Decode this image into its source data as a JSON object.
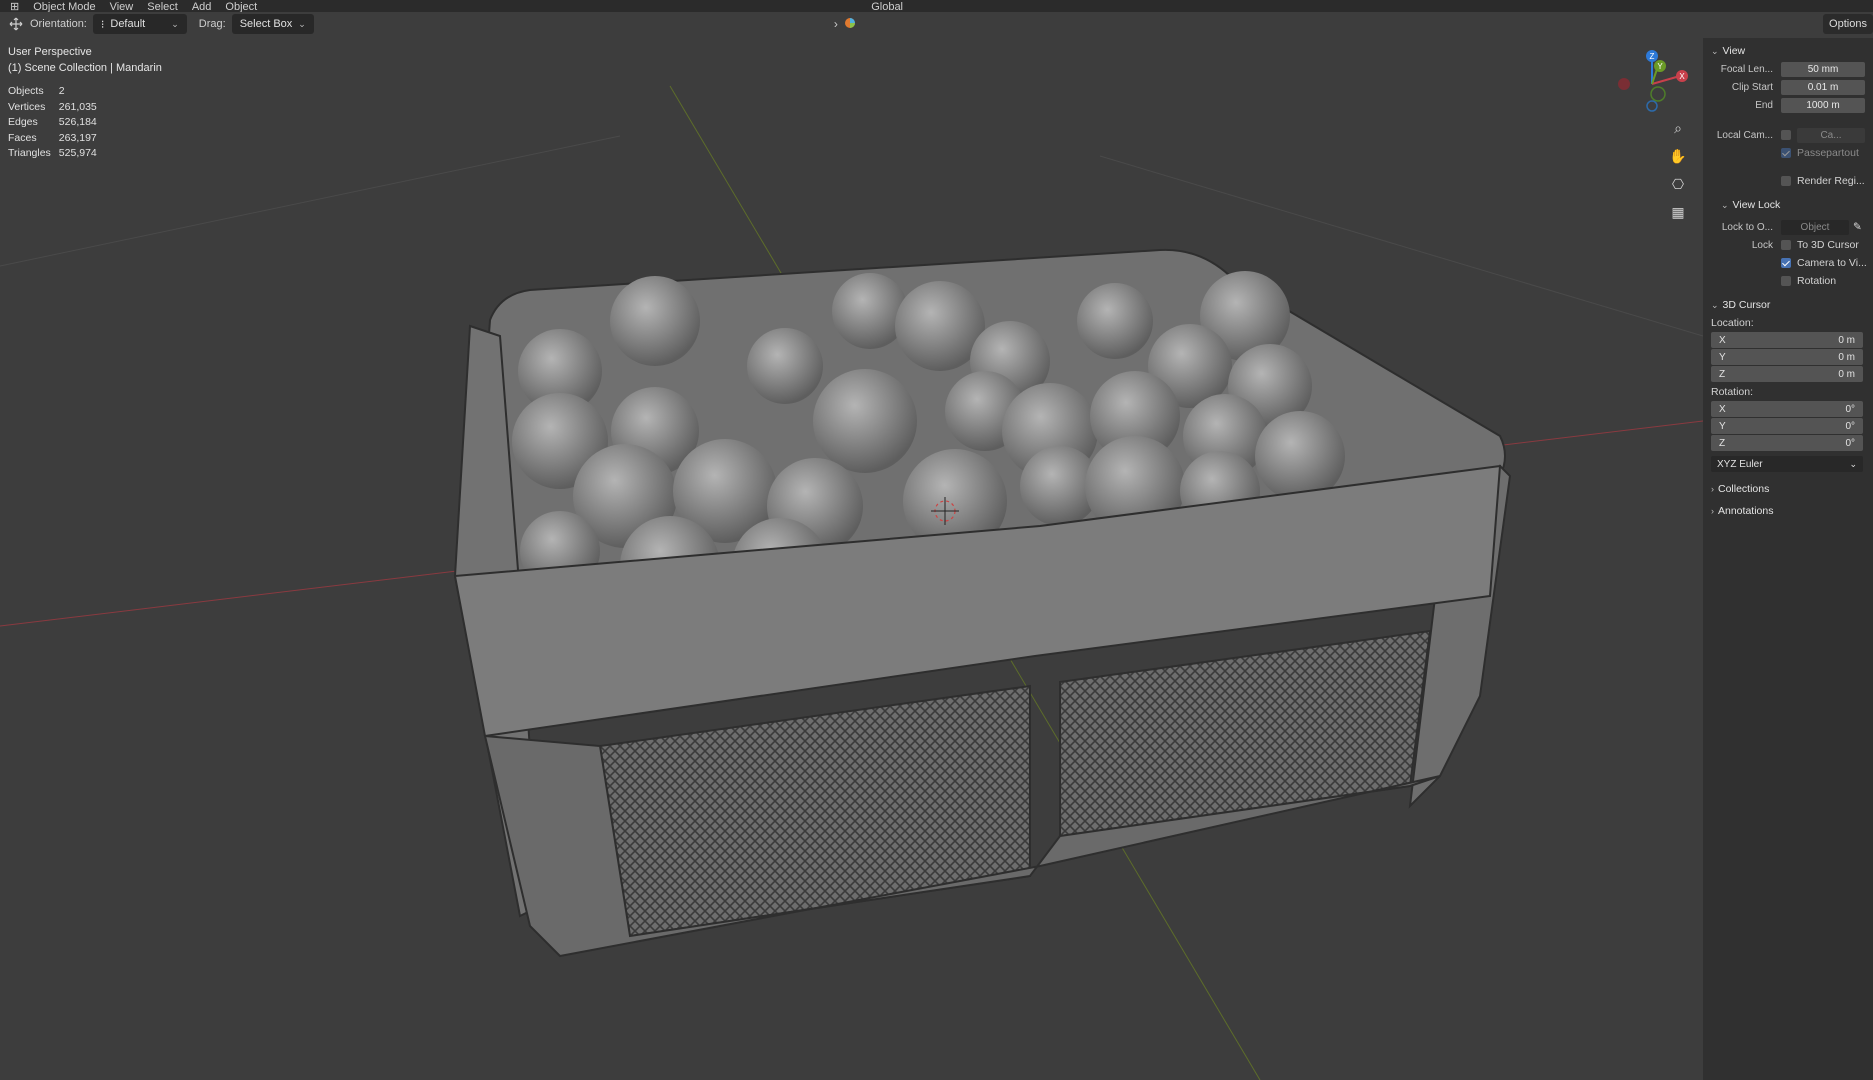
{
  "header": {
    "mode": "Object Mode",
    "menu": [
      "View",
      "Select",
      "Add",
      "Object"
    ],
    "transform_orientation": "Global"
  },
  "toolbar": {
    "orientation_label": "Orientation:",
    "orientation_value": "Default",
    "drag_label": "Drag:",
    "drag_value": "Select Box",
    "options_label": "Options"
  },
  "viewport": {
    "perspective": "User Perspective",
    "collection": "(1) Scene Collection | Mandarin",
    "stats": [
      {
        "label": "Objects",
        "value": "2"
      },
      {
        "label": "Vertices",
        "value": "261,035"
      },
      {
        "label": "Edges",
        "value": "526,184"
      },
      {
        "label": "Faces",
        "value": "263,197"
      },
      {
        "label": "Triangles",
        "value": "525,974"
      }
    ],
    "gizmo": {
      "z": "Z",
      "y": "Y",
      "x": "X"
    }
  },
  "sidebar": {
    "view": {
      "title": "View",
      "focal_label": "Focal Len...",
      "focal_value": "50 mm",
      "clip_start_label": "Clip Start",
      "clip_start_value": "0.01 m",
      "clip_end_label": "End",
      "clip_end_value": "1000 m",
      "local_cam_label": "Local Cam...",
      "local_cam_value": "Ca...",
      "passepartout": "Passepartout",
      "render_region": "Render Regi..."
    },
    "view_lock": {
      "title": "View Lock",
      "lock_to_label": "Lock to O...",
      "lock_to_placeholder": "Object",
      "lock_label": "Lock",
      "to_cursor": "To 3D Cursor",
      "camera_to_view": "Camera to Vi...",
      "rotation": "Rotation"
    },
    "cursor": {
      "title": "3D Cursor",
      "location_label": "Location:",
      "loc": [
        {
          "axis": "X",
          "value": "0 m"
        },
        {
          "axis": "Y",
          "value": "0 m"
        },
        {
          "axis": "Z",
          "value": "0 m"
        }
      ],
      "rotation_label": "Rotation:",
      "rot": [
        {
          "axis": "X",
          "value": "0°"
        },
        {
          "axis": "Y",
          "value": "0°"
        },
        {
          "axis": "Z",
          "value": "0°"
        }
      ],
      "rotation_mode": "XYZ Euler"
    },
    "collections": "Collections",
    "annotations": "Annotations"
  },
  "colors": {
    "viewport_bg": "#3d3d3d",
    "panel_bg": "#303030",
    "field_bg": "#545454",
    "accent": "#4772b3",
    "axis_x": "#c8404b",
    "axis_y": "#6a9a26",
    "axis_z": "#2d7ad9"
  }
}
